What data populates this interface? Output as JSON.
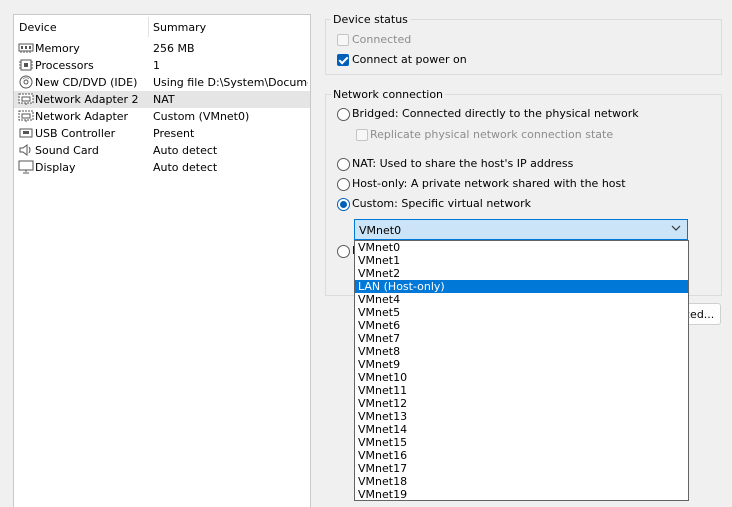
{
  "device_list": {
    "header": {
      "device": "Device",
      "summary": "Summary"
    },
    "rows": [
      {
        "name": "Memory",
        "summary": "256 MB",
        "icon": "memory-icon"
      },
      {
        "name": "Processors",
        "summary": "1",
        "icon": "processor-icon"
      },
      {
        "name": "New CD/DVD (IDE)",
        "summary": "Using file D:\\System\\Docume...",
        "icon": "cd-dvd-icon"
      },
      {
        "name": "Network Adapter 2",
        "summary": "NAT",
        "icon": "network-adapter-icon"
      },
      {
        "name": "Network Adapter",
        "summary": "Custom (VMnet0)",
        "icon": "network-adapter-icon"
      },
      {
        "name": "USB Controller",
        "summary": "Present",
        "icon": "usb-icon"
      },
      {
        "name": "Sound Card",
        "summary": "Auto detect",
        "icon": "speaker-icon"
      },
      {
        "name": "Display",
        "summary": "Auto detect",
        "icon": "monitor-icon"
      }
    ],
    "selected_index": 3
  },
  "device_status": {
    "title": "Device status",
    "connected": "Connected",
    "connect_at_power_on": "Connect at power on"
  },
  "network_connection": {
    "title": "Network connection",
    "bridged": "Bridged: Connected directly to the physical network",
    "replicate": "Replicate physical network connection state",
    "nat": "NAT: Used to share the host's IP address",
    "host_only": "Host-only: A private network shared with the host",
    "custom": "Custom: Specific virtual network",
    "selected_network": "VMnet0",
    "hidden_radio_fragment": "L"
  },
  "dropdown": {
    "options": [
      "VMnet0",
      "VMnet1",
      "VMnet2",
      "LAN (Host-only)",
      "VMnet4",
      "VMnet5",
      "VMnet6",
      "VMnet7",
      "VMnet8",
      "VMnet9",
      "VMnet10",
      "VMnet11",
      "VMnet12",
      "VMnet13",
      "VMnet14",
      "VMnet15",
      "VMnet16",
      "VMnet17",
      "VMnet18",
      "VMnet19"
    ],
    "highlighted": "LAN (Host-only)"
  },
  "advanced_button": {
    "label": "ced..."
  },
  "colors": {
    "accent": "#005fb8",
    "highlight": "#0078d7"
  }
}
